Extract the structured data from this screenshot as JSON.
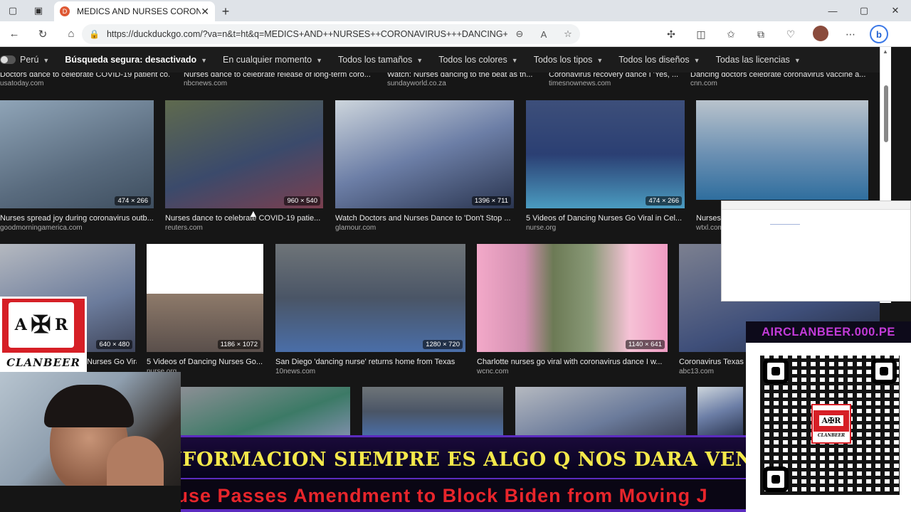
{
  "browser": {
    "tab_title": "MEDICS AND NURSES CORONAVIRUS DANCING",
    "url": "https://duckduckgo.com/?va=n&t=ht&q=MEDICS+AND++NURSES++CORONAVIRUS+++DANCING++&ia...",
    "favicon_glyph": "D",
    "new_tab_glyph": "+",
    "close_glyph": "✕",
    "minimize_glyph": "—",
    "maximize_glyph": "▢",
    "window_close_glyph": "✕"
  },
  "filters": [
    {
      "label": "Perú",
      "bold": false
    },
    {
      "label": "Búsqueda segura: desactivado",
      "bold": true
    },
    {
      "label": "En cualquier momento",
      "bold": false
    },
    {
      "label": "Todos los tamaños",
      "bold": false
    },
    {
      "label": "Todos los colores",
      "bold": false
    },
    {
      "label": "Todos los tipos",
      "bold": false
    },
    {
      "label": "Todos los diseños",
      "bold": false
    },
    {
      "label": "Todas las licencias",
      "bold": false
    }
  ],
  "rows": [
    {
      "items": [
        {
          "caption": "Doctors dance to celebrate COVID-19 patient co...",
          "source": "usatoday.com"
        },
        {
          "caption": "Nurses dance to celebrate release of long-term coro...",
          "source": "nbcnews.com"
        },
        {
          "caption": "Watch: Nurses dancing to the beat as th...",
          "source": "sundayworld.co.za"
        },
        {
          "caption": "Coronavirus recovery dance I 'Yes, ...",
          "source": "timesnownews.com"
        },
        {
          "caption": "Dancing doctors celebrate coronavirus vaccine a...",
          "source": "cnn.com"
        }
      ]
    },
    {
      "items": [
        {
          "caption": "Nurses spread joy during coronavirus outb...",
          "source": "goodmorningamerica.com",
          "dim": "474 × 266"
        },
        {
          "caption": "Nurses dance to celebrate COVID-19 patie...",
          "source": "reuters.com",
          "dim": "960 × 540"
        },
        {
          "caption": "Watch Doctors and Nurses Dance to 'Don't Stop ...",
          "source": "glamour.com",
          "dim": "1396 × 711"
        },
        {
          "caption": "5 Videos of Dancing Nurses Go Viral in Cel...",
          "source": "nurse.org",
          "dim": "474 × 266"
        },
        {
          "caption": "Nurses",
          "source": "wtxl.com",
          "dim": ""
        }
      ]
    },
    {
      "items": [
        {
          "caption": "Nurses Go Viral i...",
          "source": "",
          "dim": "640 × 480"
        },
        {
          "caption": "5 Videos of Dancing Nurses Go...",
          "source": "nurse.org",
          "dim": "1186 × 1072"
        },
        {
          "caption": "San Diego 'dancing nurse' returns home from Texas",
          "source": "10news.com",
          "dim": "1280 × 720"
        },
        {
          "caption": "Charlotte nurses go viral with coronavirus dance I w...",
          "source": "wcnc.com",
          "dim": "1140 × 641"
        },
        {
          "caption": "Coronavirus Texas",
          "source": "abc13.com",
          "dim": ""
        }
      ]
    }
  ],
  "overlay": {
    "logo_letter_left": "A",
    "logo_letter_right": "R",
    "logo_cross": "✠",
    "logo_word": "CLANBEER",
    "qr_header": "AIRCLANBEER.000.PE",
    "qr_logo_text": "A✠R",
    "qr_logo_word": "CLANBEER",
    "ticker_top": "INFORMACION SIEMPRE ES ALGO Q NOS DARA VENTAJA",
    "ticker_bottom": "ouse Passes Amendment to Block Biden from Moving J"
  }
}
